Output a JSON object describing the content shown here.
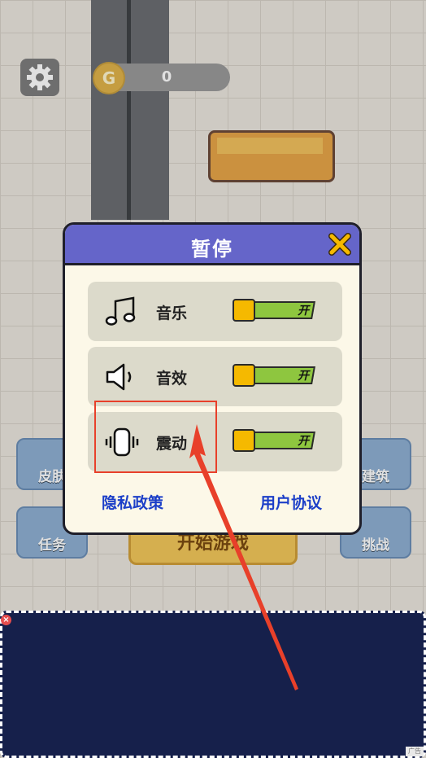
{
  "hud": {
    "coin_symbol": "G",
    "coin_count": "0"
  },
  "dialog": {
    "title": "暂停",
    "rows": [
      {
        "label": "音乐",
        "icon": "music-note-icon",
        "toggle_text": "开"
      },
      {
        "label": "音效",
        "icon": "speaker-icon",
        "toggle_text": "开"
      },
      {
        "label": "震动",
        "icon": "vibrate-icon",
        "toggle_text": "开"
      }
    ],
    "privacy_link": "隐私政策",
    "agreement_link": "用户协议"
  },
  "background_buttons": {
    "skin": "皮肤",
    "task": "任务",
    "build": "建筑",
    "challenge": "挑战",
    "start": "开始游戏"
  },
  "ad": {
    "tag": "广告"
  },
  "colors": {
    "dialog_header": "#6565c9",
    "toggle_on": "#8ec63f",
    "toggle_knob": "#f5b900",
    "link": "#1c3fc8",
    "highlight": "#e8402a",
    "ad_background": "#16204b"
  }
}
